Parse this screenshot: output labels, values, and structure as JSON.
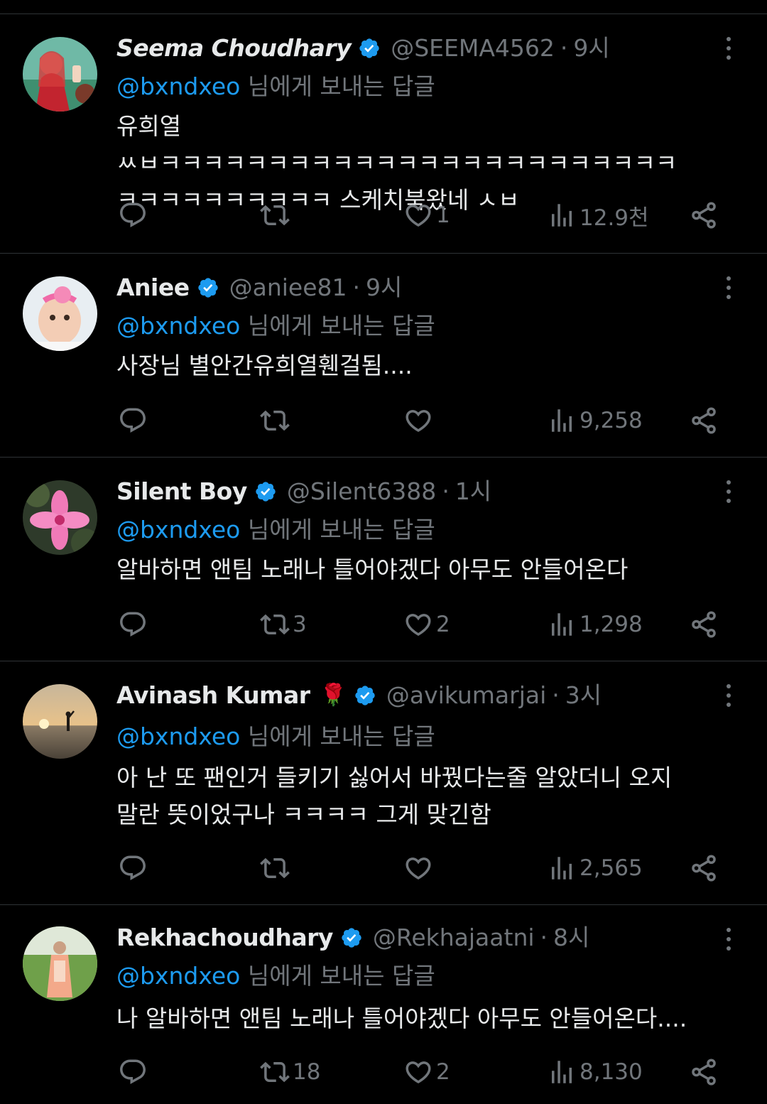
{
  "colors": {
    "background": "#000000",
    "text": "#e7e9ea",
    "muted": "#71767b",
    "accent": "#1d9bf0",
    "divider": "#2f3336"
  },
  "icons": {
    "verified": "verified-badge-icon",
    "more": "more-icon",
    "reply": "reply-icon",
    "retweet": "retweet-icon",
    "like": "heart-icon",
    "views": "views-chart-icon",
    "share": "share-icon"
  },
  "tweets": [
    {
      "name": "Seema Choudhary",
      "handle": "@SEEMA4562",
      "dot": "·",
      "time": "9시",
      "reply_mention": "@bxndxeo",
      "reply_suffix": " 님에게 보내는 답글",
      "text": "유희열 ㅆㅂㅋㅋㅋㅋㅋㅋㅋㅋㅋㅋㅋㅋㅋㅋㅋㅋㅋㅋㅋㅋㅋㅋㅋㅋ\nㅋㅋㅋㅋㅋㅋㅋㅋㅋㅋ 스케치북왔네 ㅅㅂ",
      "replies": "",
      "retweets": "",
      "likes": "1",
      "views": "12.9천"
    },
    {
      "name": "Aniee",
      "handle": "@aniee81",
      "dot": "·",
      "time": "9시",
      "reply_mention": "@bxndxeo",
      "reply_suffix": " 님에게 보내는 답글",
      "text": "사장님 별안간유희열휀걸됨....",
      "replies": "",
      "retweets": "",
      "likes": "",
      "views": "9,258"
    },
    {
      "name": "Silent Boy",
      "handle": "@Silent6388",
      "dot": "·",
      "time": "1시",
      "reply_mention": "@bxndxeo",
      "reply_suffix": " 님에게 보내는 답글",
      "text": "알바하면 앤팀 노래나 틀어야겠다 아무도 안들어온다",
      "replies": "",
      "retweets": "3",
      "likes": "2",
      "views": "1,298"
    },
    {
      "name": "Avinash Kumar",
      "name_emoji": "🌹",
      "handle": "@avikumarjai",
      "dot": "·",
      "time": "3시",
      "reply_mention": "@bxndxeo",
      "reply_suffix": " 님에게 보내는 답글",
      "text": "아 난 또 팬인거 들키기 싫어서 바꿨다는줄 알았더니 오지\n말란 뜻이었구나 ㅋㅋㅋㅋ 그게 맞긴함",
      "replies": "",
      "retweets": "",
      "likes": "",
      "views": "2,565"
    },
    {
      "name": "Rekhachoudhary",
      "handle": "@Rekhajaatni",
      "dot": "·",
      "time": "8시",
      "reply_mention": "@bxndxeo",
      "reply_suffix": " 님에게 보내는 답글",
      "text": "나 알바하면 앤팀 노래나 틀어야겠다 아무도 안들어온다....",
      "replies": "",
      "retweets": "18",
      "likes": "2",
      "views": "8,130"
    }
  ]
}
